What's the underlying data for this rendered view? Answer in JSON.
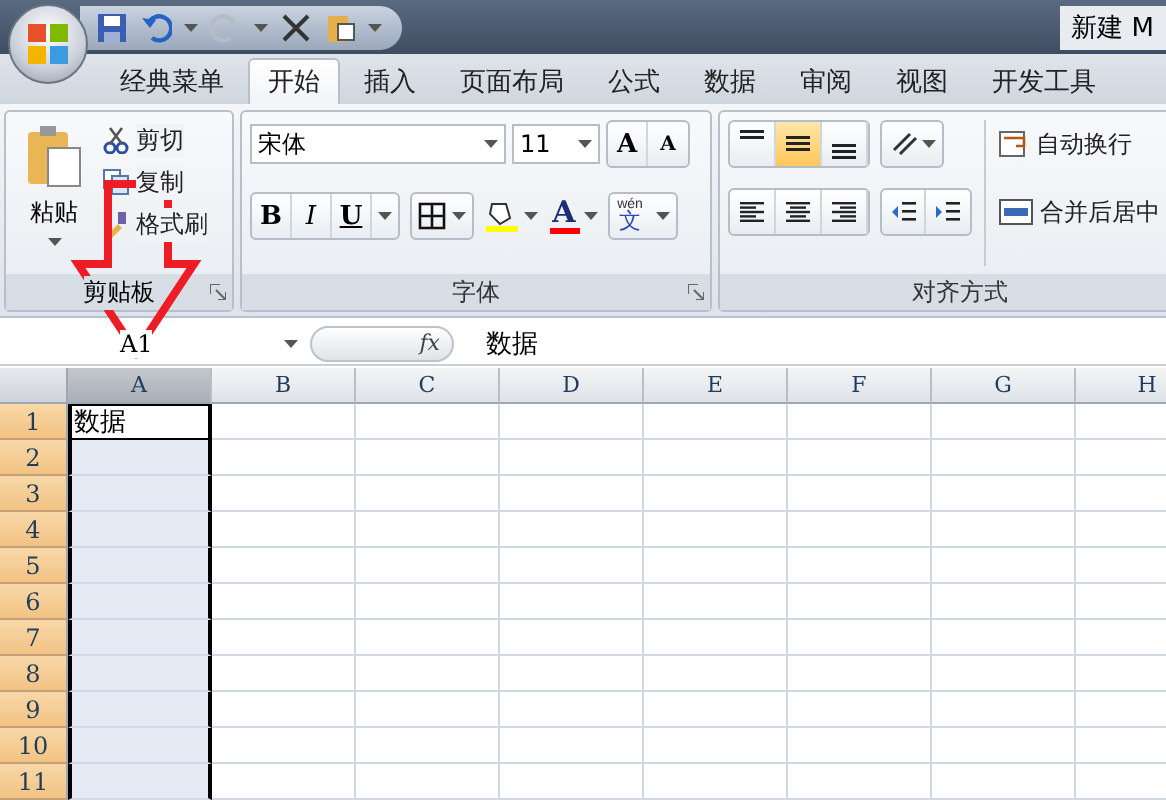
{
  "title_bar": {
    "title": "新建 M"
  },
  "tabs": [
    {
      "label": "经典菜单",
      "selected": false
    },
    {
      "label": "开始",
      "selected": true
    },
    {
      "label": "插入",
      "selected": false
    },
    {
      "label": "页面布局",
      "selected": false
    },
    {
      "label": "公式",
      "selected": false
    },
    {
      "label": "数据",
      "selected": false
    },
    {
      "label": "审阅",
      "selected": false
    },
    {
      "label": "视图",
      "selected": false
    },
    {
      "label": "开发工具",
      "selected": false
    }
  ],
  "clipboard": {
    "paste": "粘贴",
    "items": [
      "剪切",
      "复制",
      "格式刷"
    ],
    "label": "剪贴板"
  },
  "font": {
    "name": "宋体",
    "size": "11",
    "grow": "A",
    "shrink": "A",
    "bold": "B",
    "italic": "I",
    "underline": "U",
    "color_letter": "A",
    "phonetic_top": "wén",
    "phonetic": "文",
    "label": "字体"
  },
  "alignment": {
    "vertical": [
      {
        "selected": false
      },
      {
        "selected": true
      },
      {
        "selected": false
      }
    ],
    "wrap": "自动换行",
    "merge": "合并后居中",
    "label": "对齐方式"
  },
  "formula_bar": {
    "name_box": "A1",
    "fx": "fx",
    "value": "数据"
  },
  "sheet": {
    "columns": [
      {
        "label": "A",
        "selected": true
      },
      {
        "label": "B",
        "selected": false
      },
      {
        "label": "C",
        "selected": false
      },
      {
        "label": "D",
        "selected": false
      },
      {
        "label": "E",
        "selected": false
      },
      {
        "label": "F",
        "selected": false
      },
      {
        "label": "G",
        "selected": false
      },
      {
        "label": "H",
        "selected": false
      }
    ],
    "rows": [
      {
        "label": "1",
        "selected": true,
        "cells": [
          {
            "text": "数据",
            "active": true
          }
        ]
      },
      {
        "label": "2",
        "selected": true
      },
      {
        "label": "3",
        "selected": true
      },
      {
        "label": "4",
        "selected": true
      },
      {
        "label": "5",
        "selected": true
      },
      {
        "label": "6",
        "selected": true
      },
      {
        "label": "7",
        "selected": true
      },
      {
        "label": "8",
        "selected": true
      },
      {
        "label": "9",
        "selected": true
      },
      {
        "label": "10",
        "selected": true
      },
      {
        "label": "11",
        "selected": true
      }
    ]
  }
}
